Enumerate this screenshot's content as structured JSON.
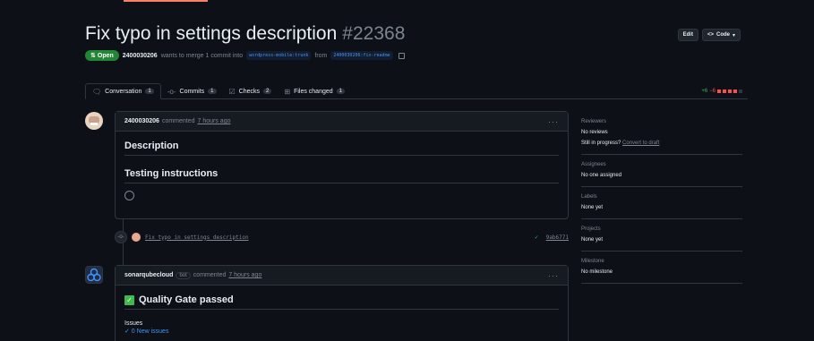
{
  "pr": {
    "title": "Fix typo in settings description",
    "number": "#22368",
    "state": "Open",
    "author": "2400030206",
    "merge_text": "wants to merge 1 commit into",
    "base_branch": "wordpress-mobile:trunk",
    "from_text": "from",
    "head_branch": "2400030206:fix-readme",
    "edit_label": "Edit",
    "code_label": "Code"
  },
  "tabs": [
    {
      "label": "Conversation",
      "count": "1"
    },
    {
      "label": "Commits",
      "count": "1"
    },
    {
      "label": "Checks",
      "count": "2"
    },
    {
      "label": "Files changed",
      "count": "1"
    }
  ],
  "diffstat": {
    "additions": "+6",
    "deletions": "−6"
  },
  "comment1": {
    "author": "2400030206",
    "action": "commented",
    "time": "7 hours ago",
    "heading1": "Description",
    "heading2": "Testing instructions"
  },
  "commit": {
    "message": "Fix typo in settings description",
    "sha": "9ab6771"
  },
  "comment2": {
    "author": "sonarqubecloud",
    "badge": "bot",
    "action": "commented",
    "time": "7 hours ago",
    "heading": "Quality Gate passed",
    "issues_label": "Issues",
    "issues_value": "✓ 0 New issues"
  },
  "sidebar": {
    "reviewers_title": "Reviewers",
    "reviewers_value": "No reviews",
    "still_in_progress": "Still in progress?",
    "convert_draft": "Convert to draft",
    "assignees_title": "Assignees",
    "assignees_value": "No one assigned",
    "labels_title": "Labels",
    "labels_value": "None yet",
    "projects_title": "Projects",
    "projects_value": "None yet",
    "milestone_title": "Milestone",
    "milestone_value": "No milestone"
  },
  "colors": {
    "open_green": "#238636",
    "link_blue": "#4493f8",
    "add": "#3fb950",
    "del": "#f85149"
  }
}
